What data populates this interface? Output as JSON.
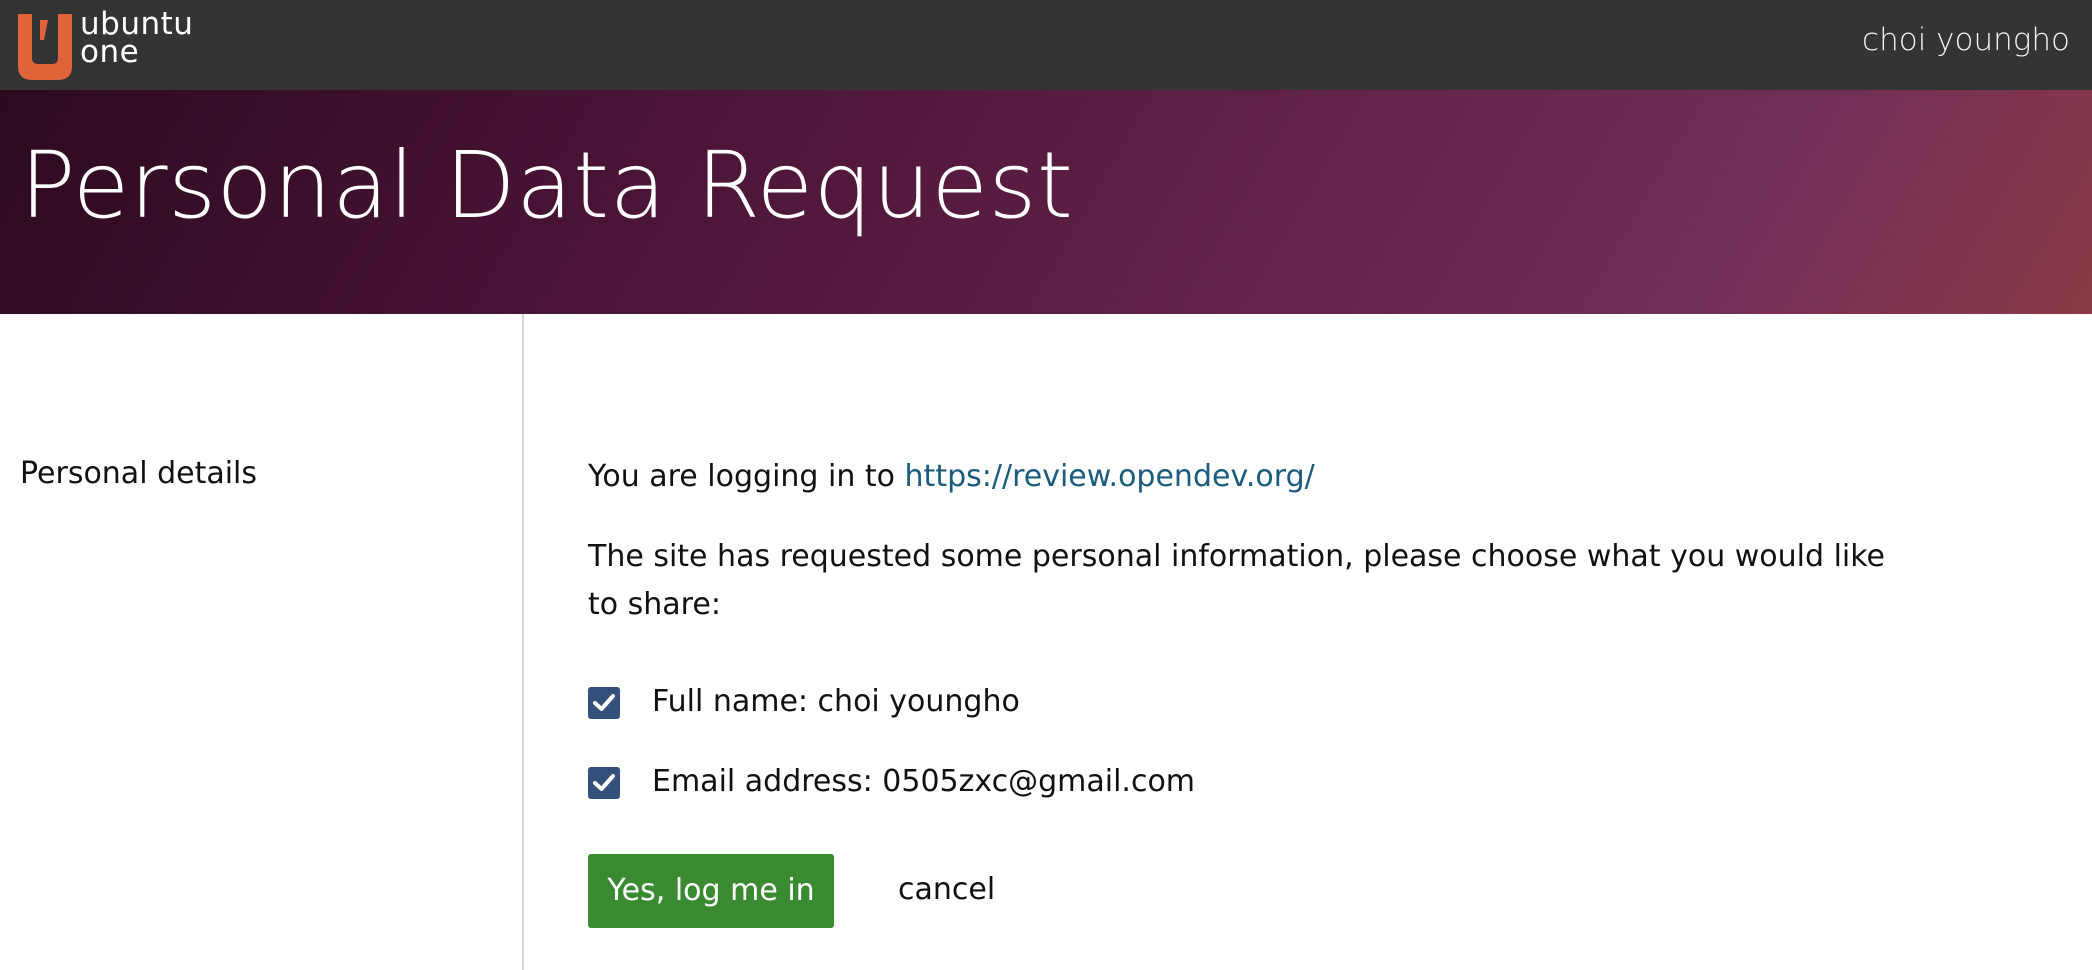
{
  "header": {
    "logo_line1": "ubuntu",
    "logo_line2": "one",
    "username": "choi youngho"
  },
  "banner": {
    "title": "Personal Data Request"
  },
  "sidebar": {
    "section_label": "Personal details"
  },
  "main": {
    "login_prefix": "You are logging in to ",
    "site_url": "https://review.opendev.org/",
    "request_text": "The site has requested some personal information, please choose what you would like to share:",
    "fields": [
      {
        "label": "Full name: choi youngho",
        "checked": true
      },
      {
        "label": "Email address: 0505zxc@gmail.com",
        "checked": true
      }
    ],
    "confirm_button": "Yes, log me in",
    "cancel_link": "cancel"
  },
  "colors": {
    "topbar": "#343434",
    "logo_orange": "#e0633a",
    "banner_start": "#2c0a1e",
    "banner_end": "#8a3a47",
    "link": "#1b5b7c",
    "checkbox": "#34507a",
    "button_green": "#3a8a32"
  },
  "icons": {
    "logo": "ubuntu-one-logo-icon",
    "checkbox": "checkmark-icon"
  }
}
